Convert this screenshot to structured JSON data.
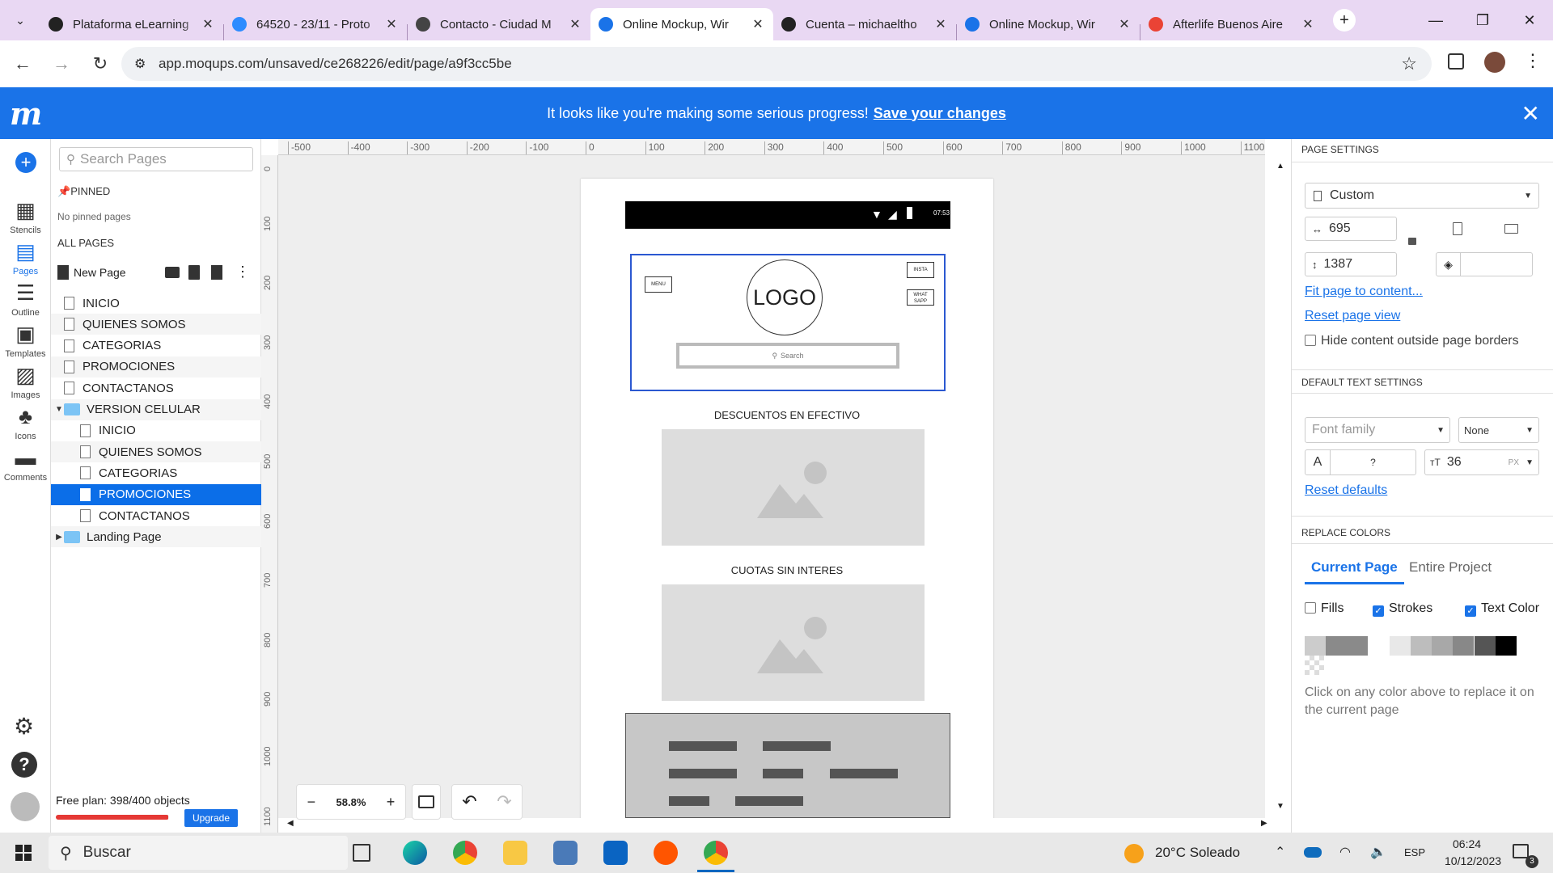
{
  "browser": {
    "tabs": [
      {
        "title": "Plataforma eLearning",
        "icon": "elearning-icon",
        "color": "#222222"
      },
      {
        "title": "64520 - 23/11 - Proto",
        "icon": "zoom-icon",
        "color": "#2d8cff"
      },
      {
        "title": "Contacto - Ciudad M",
        "icon": "site-icon",
        "color": "#444444"
      },
      {
        "title": "Online Mockup, Wir",
        "icon": "moqups-icon",
        "color": "#1a73e8",
        "active": true
      },
      {
        "title": "Cuenta – michaeltho",
        "icon": "h-icon",
        "color": "#222222"
      },
      {
        "title": "Online Mockup, Wir",
        "icon": "moqups-icon",
        "color": "#1a73e8"
      },
      {
        "title": "Afterlife Buenos Aire",
        "icon": "gmail-icon",
        "color": "#ea4335"
      }
    ],
    "url": "app.moqups.com/unsaved/ce268226/edit/page/a9f3cc5be"
  },
  "banner": {
    "message": "It looks like you're making some serious progress!",
    "link": "Save your changes",
    "logo": "m"
  },
  "left_rail": [
    {
      "label": "Stencils",
      "icon": "stencils-icon"
    },
    {
      "label": "Pages",
      "icon": "pages-icon",
      "active": true
    },
    {
      "label": "Outline",
      "icon": "outline-icon"
    },
    {
      "label": "Templates",
      "icon": "templates-icon"
    },
    {
      "label": "Images",
      "icon": "images-icon"
    },
    {
      "label": "Icons",
      "icon": "club-icon"
    },
    {
      "label": "Comments",
      "icon": "comments-icon"
    }
  ],
  "pages_panel": {
    "search_placeholder": "Search Pages",
    "pinned_label": "PINNED",
    "no_pinned": "No pinned pages",
    "all_pages_label": "ALL PAGES",
    "new_page": "New Page",
    "pages": [
      {
        "label": "INICIO",
        "type": "page",
        "level": 0
      },
      {
        "label": "QUIENES SOMOS",
        "type": "page",
        "level": 0
      },
      {
        "label": "CATEGORIAS",
        "type": "page",
        "level": 0
      },
      {
        "label": "PROMOCIONES",
        "type": "page",
        "level": 0
      },
      {
        "label": "CONTACTANOS",
        "type": "page",
        "level": 0
      },
      {
        "label": "VERSION CELULAR",
        "type": "folder",
        "level": 0,
        "expanded": true
      },
      {
        "label": "INICIO",
        "type": "page",
        "level": 1
      },
      {
        "label": "QUIENES SOMOS",
        "type": "page",
        "level": 1
      },
      {
        "label": "CATEGORIAS",
        "type": "page",
        "level": 1
      },
      {
        "label": "PROMOCIONES",
        "type": "page",
        "level": 1,
        "selected": true
      },
      {
        "label": "CONTACTANOS",
        "type": "page",
        "level": 1
      },
      {
        "label": "Landing Page",
        "type": "folder",
        "level": 0,
        "expanded": false
      }
    ],
    "plan_text": "Free plan: 398/400 objects",
    "plan_progress": 0.995,
    "upgrade": "Upgrade"
  },
  "rulers": {
    "top": [
      "-500",
      "-400",
      "-300",
      "-200",
      "-100",
      "0",
      "100",
      "200",
      "300",
      "400",
      "500",
      "600",
      "700",
      "800",
      "900",
      "1000",
      "1100"
    ],
    "left": [
      "0",
      "100",
      "200",
      "300",
      "400",
      "500",
      "600",
      "700",
      "800",
      "900",
      "1000",
      "1100"
    ]
  },
  "mockup": {
    "status_time": "07:53",
    "menu_label": "MENU",
    "logo_label": "LOGO",
    "insta_label": "INSTA",
    "whatsapp_label": "WHAT SAPP",
    "search_label": "Search",
    "section1": "DESCUENTOS EN EFECTIVO",
    "section2": "CUOTAS SIN INTERES"
  },
  "zoom": {
    "level": "58.8%",
    "minus": "−",
    "plus": "+"
  },
  "page_settings": {
    "header": "PAGE SETTINGS",
    "size_preset": "Custom",
    "width": "695",
    "height": "1387",
    "fit_link": "Fit page to content...",
    "reset_link": "Reset page view",
    "hide_label": "Hide content outside page borders"
  },
  "text_settings": {
    "header": "DEFAULT TEXT SETTINGS",
    "font_family": "Font family",
    "font_style": "None",
    "color_value": "?",
    "font_size": "36",
    "unit": "PX",
    "reset": "Reset defaults"
  },
  "replace_colors": {
    "header": "REPLACE COLORS",
    "tab_current": "Current Page",
    "tab_entire": "Entire Project",
    "fills": "Fills",
    "strokes": "Strokes",
    "text_color": "Text Color",
    "swatches": [
      "#cccccc",
      "#8a8a8a",
      "#8a8a8a",
      "#ffffff",
      "#e8e8e8",
      "#bdbdbd",
      "#a8a8a8",
      "#888888",
      "#555555",
      "#000000"
    ],
    "hint": "Click on any color above to replace it on the current page"
  },
  "taskbar": {
    "search": "Buscar",
    "weather": "20°C Soleado",
    "lang": "ESP",
    "time": "06:24",
    "date": "10/12/2023",
    "notif": "3"
  }
}
